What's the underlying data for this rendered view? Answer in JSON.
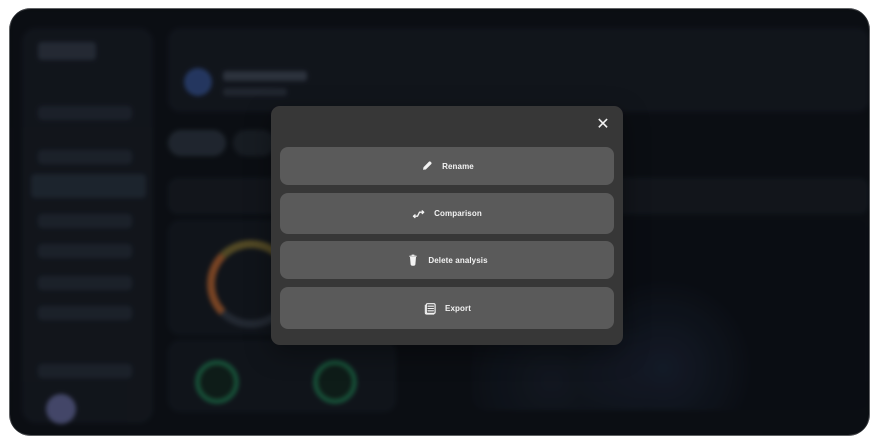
{
  "modal": {
    "close_icon": "close-icon",
    "actions": [
      {
        "label": "Rename",
        "icon": "pencil-icon"
      },
      {
        "label": "Comparison",
        "icon": "comparison-icon"
      },
      {
        "label": "Delete analysis",
        "icon": "trash-icon"
      },
      {
        "label": "Export",
        "icon": "export-icon"
      }
    ]
  },
  "colors": {
    "background": "#0d1117",
    "modal": "#373737",
    "button": "#5a5a5a",
    "text": "#f3f3f3"
  }
}
